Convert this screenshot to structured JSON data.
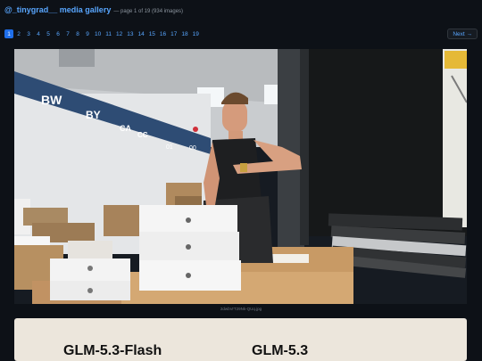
{
  "header": {
    "title": "@_tinygrad__ media gallery",
    "subtitle": "— page 1 of 19 (934 images)"
  },
  "pagination": {
    "pages": [
      "1",
      "2",
      "3",
      "4",
      "5",
      "6",
      "7",
      "8",
      "9",
      "10",
      "11",
      "12",
      "13",
      "14",
      "15",
      "16",
      "17",
      "18",
      "19"
    ],
    "current": "1",
    "next_label": "Next →"
  },
  "images": [
    {
      "caption": "2dwbVrT29Nk-QUq.jpg",
      "photo_text": {
        "sign_letters": [
          "BW",
          "BY",
          "CA",
          "CC",
          "01",
          "00"
        ]
      }
    },
    {
      "title_left": "GLM-5.3-Flash",
      "title_right": "GLM-5.3"
    }
  ],
  "colors": {
    "background": "#0d1117",
    "link": "#58a6ff",
    "active_page": "#1f6feb"
  }
}
